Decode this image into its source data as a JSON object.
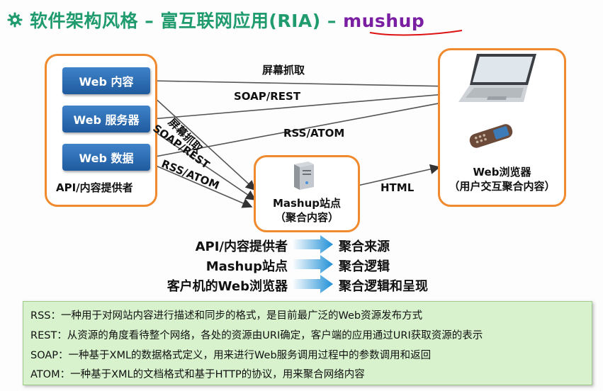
{
  "title": {
    "main": "软件架构风格 – 富互联网应用(RIA) – ",
    "emphasis": "mushup"
  },
  "providers": {
    "items": [
      "Web 内容",
      "Web 服务器",
      "Web 数据"
    ],
    "caption": "API/内容提供者"
  },
  "arrows": {
    "top_scrape": "屏幕抓取",
    "top_soap": "SOAP/REST",
    "top_rss": "RSS/ATOM",
    "diag_scrape": "屏幕抓取",
    "diag_soap": "SOAP/REST",
    "diag_rss": "RSS/ATOM",
    "html": "HTML"
  },
  "mashup": {
    "line1": "Mashup站点",
    "line2": "（聚合内容）"
  },
  "browser": {
    "line1": "Web浏览器",
    "line2": "（用户交互聚合内容）"
  },
  "mapping": [
    {
      "left": "API/内容提供者",
      "right": "聚合来源"
    },
    {
      "left": "Mashup站点",
      "right": "聚合逻辑"
    },
    {
      "left": "客户机的Web浏览器",
      "right": "聚合逻辑和呈现"
    }
  ],
  "notes": [
    "RSS：一种用于对网站内容进行描述和同步的格式，是目前最广泛的Web资源发布方式",
    "REST：从资源的角度看待整个网络，各处的资源由URI确定，客户端的应用通过URI获取资源的表示",
    "SOAP：一种基于XML的数据格式定义，用来进行Web服务调用过程中的参数调用和返回",
    "ATOM：一种基于XML的文档格式和基于HTTP的协议，用来聚合网络内容"
  ],
  "colors": {
    "title": "#1f9b6e",
    "emphasis": "#7a1fa2",
    "box_border": "#f08a2c",
    "chip": "#2d6db3",
    "arrow": "#1f8fd6",
    "note_bg": "#d7f2cc"
  },
  "icons": [
    "gear-icon",
    "laptop-icon",
    "mobile-phone-icon",
    "server-icon"
  ]
}
